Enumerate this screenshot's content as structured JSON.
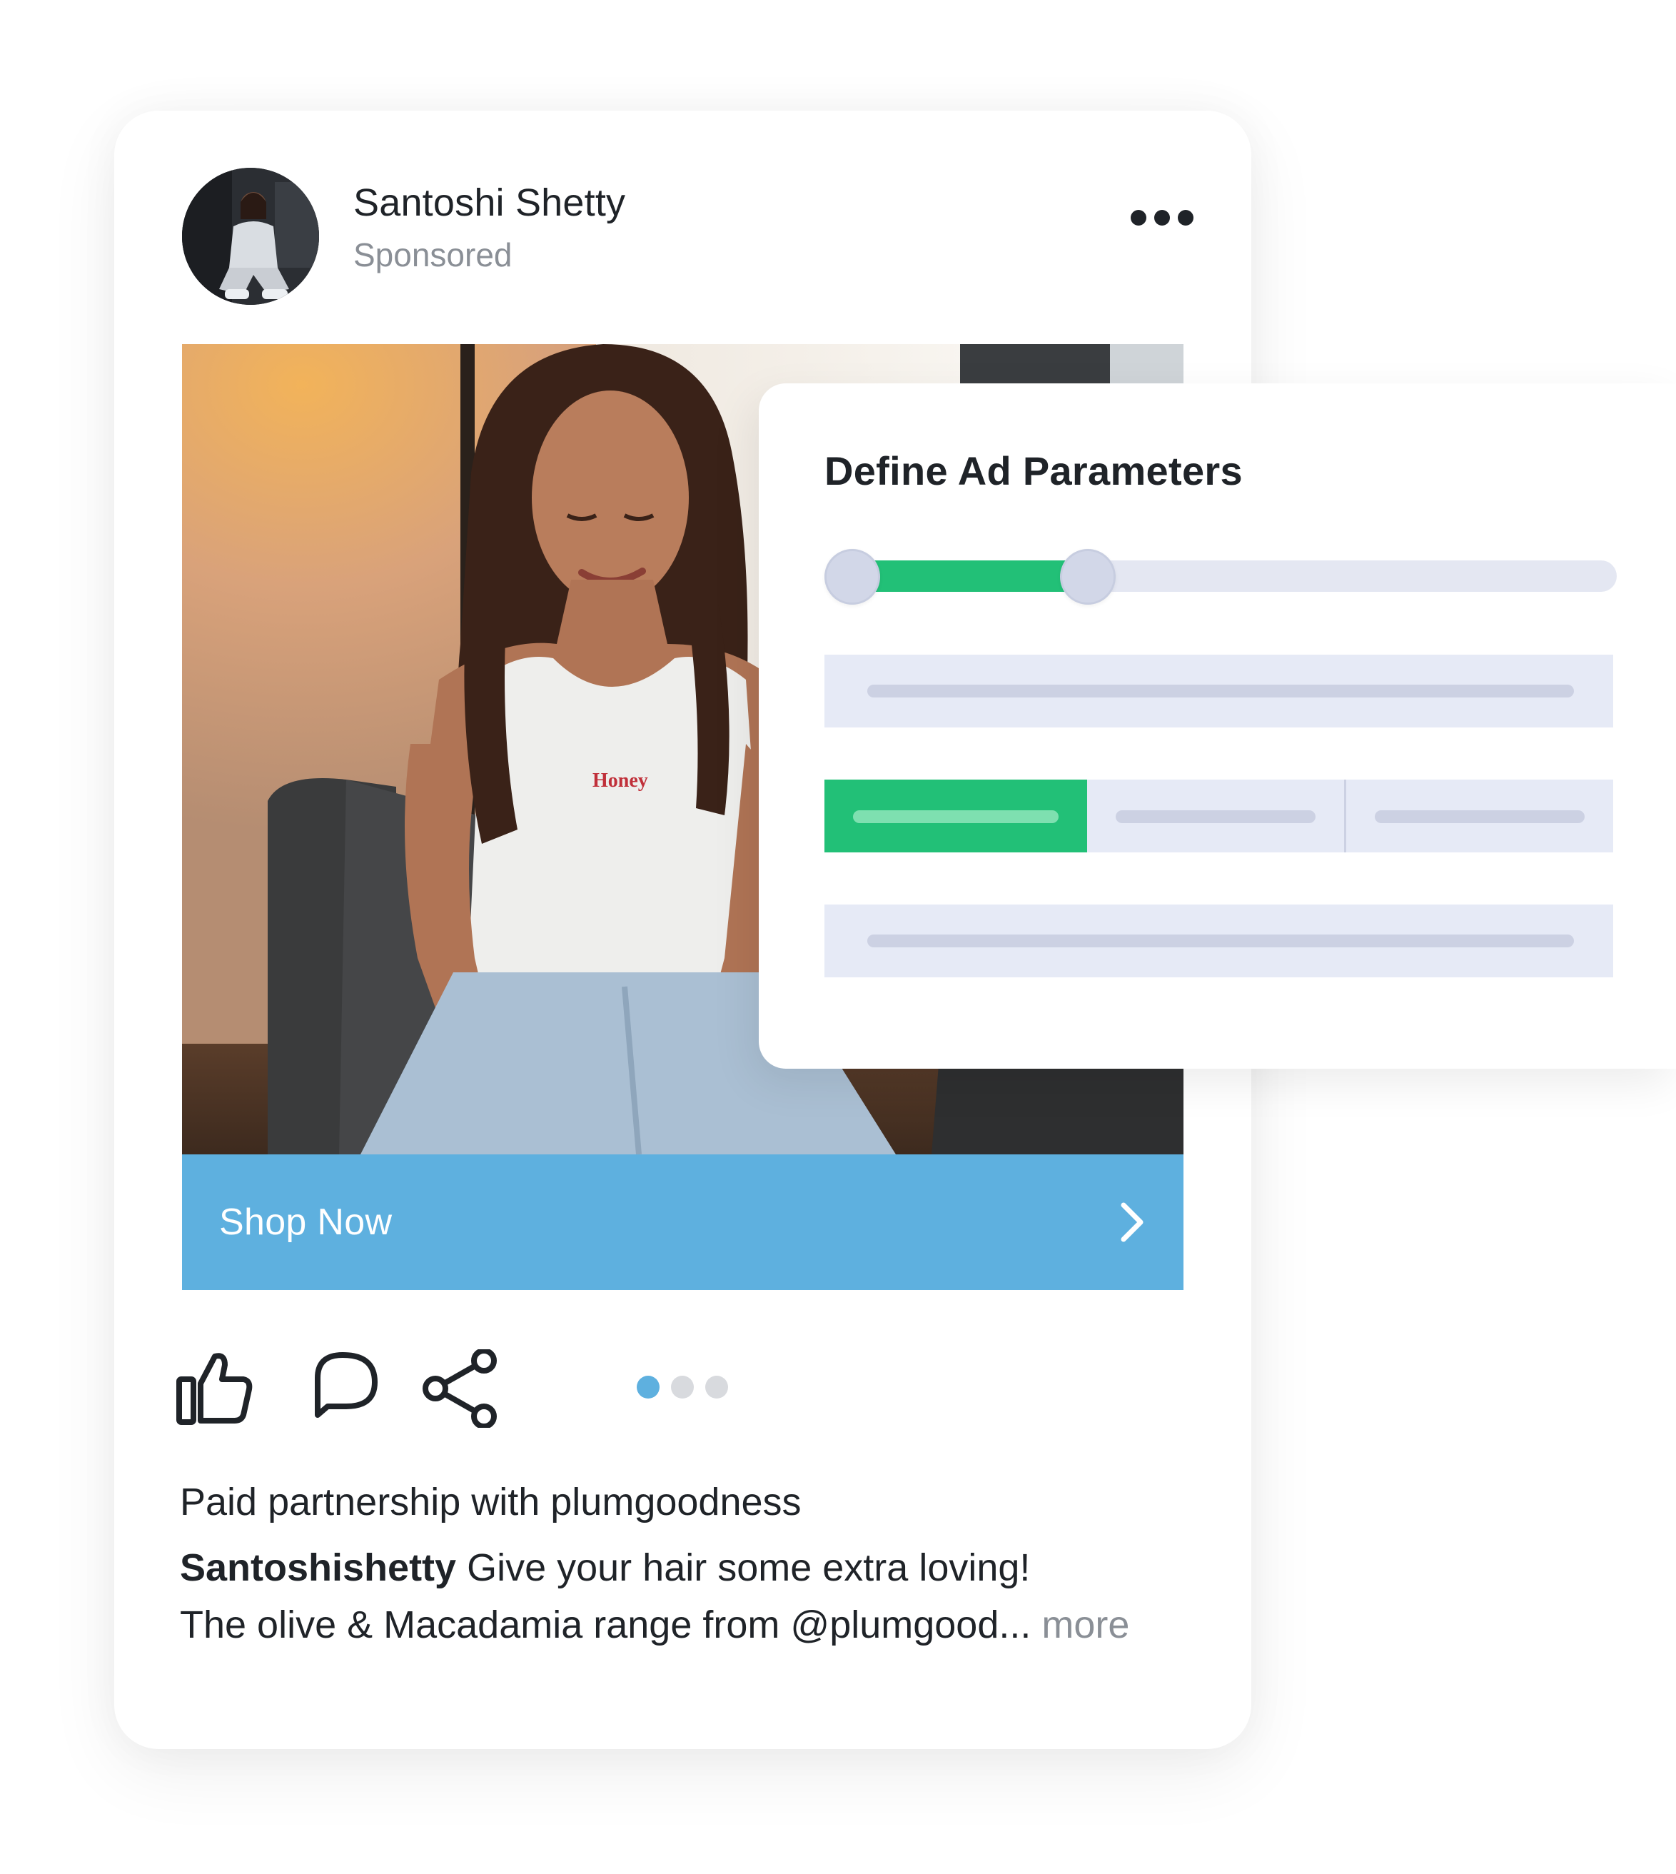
{
  "post": {
    "author_name": "Santoshi Shetty",
    "sponsored_label": "Sponsored",
    "cta_label": "Shop Now",
    "shirt_text": "Honey",
    "carousel": {
      "count": 3,
      "active_index": 0
    },
    "caption": {
      "partnership": "Paid partnership with plumgoodness",
      "handle": "Santoshishetty",
      "line1_text": " Give your hair some extra loving!",
      "line2_text": "The olive & Macadamia range from @plumgood... ",
      "more_label": "more"
    },
    "icons": [
      "more-dots-icon",
      "like-icon",
      "comment-icon",
      "share-icon",
      "chevron-right-icon"
    ]
  },
  "ad_panel": {
    "title": "Define Ad Parameters",
    "range": {
      "min": 0,
      "max": 100,
      "low": 0,
      "high": 32
    },
    "segments": {
      "count": 3,
      "selected_index": 0
    }
  },
  "colors": {
    "cta_blue": "#5eb0df",
    "accent_green": "#22c077",
    "field_bg": "#e6eaf6",
    "text_dark": "#1f2328",
    "text_muted": "#8a8f96"
  }
}
